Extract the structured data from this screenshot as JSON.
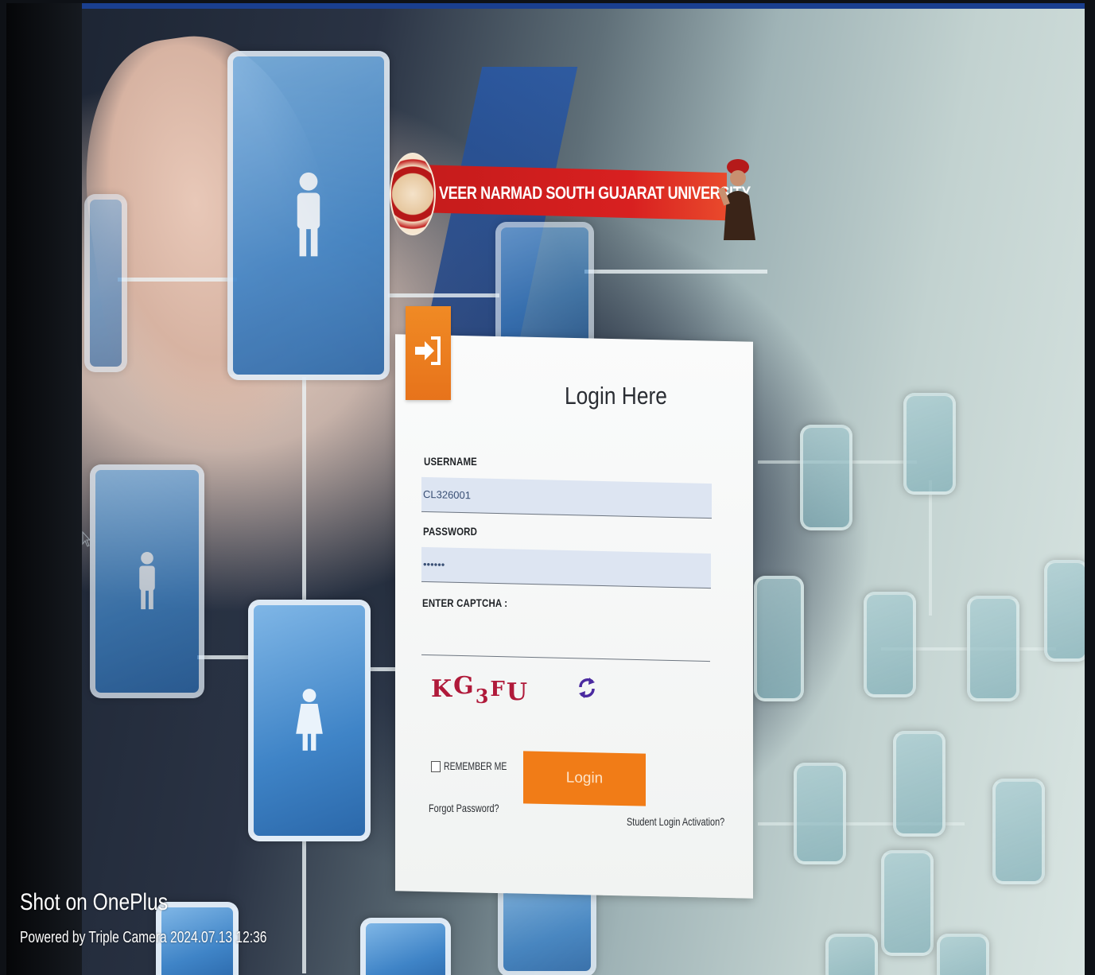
{
  "banner": {
    "university_name": "VEER NARMAD SOUTH GUJARAT UNIVERSITY",
    "seal_icon": "university-seal-icon",
    "portrait_icon": "founder-portrait-icon"
  },
  "login": {
    "title": "Login Here",
    "icon": "sign-in-arrow-icon",
    "username_label": "USERNAME",
    "username_value": "CL326001",
    "password_label": "PASSWORD",
    "password_value": "••••••",
    "captcha_label": "ENTER CAPTCHA :",
    "captcha_value": "",
    "captcha_chars": [
      "K",
      "G",
      "3",
      "F",
      "U"
    ],
    "refresh_icon": "refresh-icon",
    "remember_label": "REMEMBER ME",
    "login_button": "Login",
    "forgot_link": "Forgot Password?",
    "activation_link": "Student Login Activation?"
  },
  "watermark": {
    "line1": "Shot on OnePlus",
    "line2": "Powered by Triple Camera   2024.07.13 12:36"
  },
  "colors": {
    "accent_orange": "#f17c17",
    "banner_red": "#d82020",
    "captcha_red": "#b01a3a",
    "refresh_purple": "#4a2aa0",
    "top_bar_blue": "#1a3f8f"
  }
}
